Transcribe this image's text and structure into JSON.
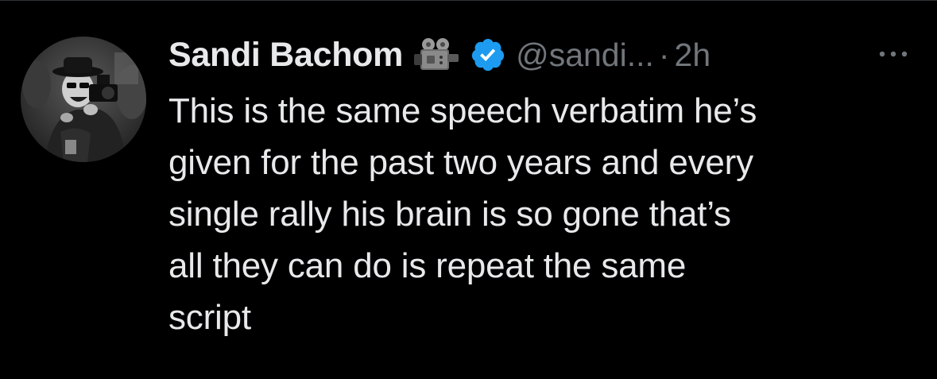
{
  "post": {
    "author": {
      "display_name": "Sandi Bachom",
      "name_emoji_icon": "video-camera-icon",
      "verified_icon": "verified-badge-icon",
      "handle": "@sandi...",
      "avatar": "avatar-photo"
    },
    "separator": "·",
    "time": "2h",
    "more_icon": "more-options-icon",
    "text": "This is the same speech verbatim he’s\ngiven for the past two years and every\nsingle rally his brain is so gone that’s\nall they can do is repeat the same\nscript"
  },
  "colors": {
    "background": "#000000",
    "text_primary": "#e7e9ea",
    "text_secondary": "#71767b",
    "verified_blue": "#1d9bf0"
  }
}
